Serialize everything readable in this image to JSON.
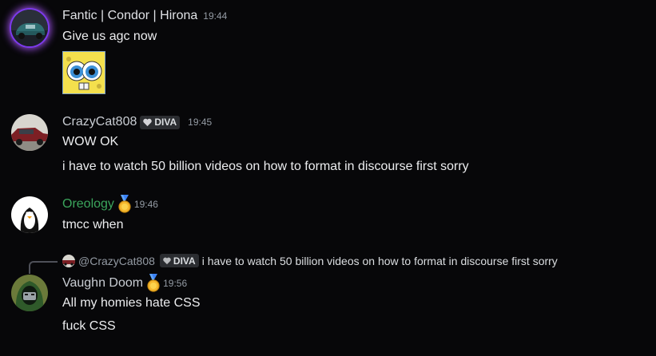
{
  "messages": [
    {
      "username": "Fantic | Condor | Hirona",
      "time": "19:44",
      "lines": [
        "Give us agc now"
      ],
      "attachment": "spongebob-emoji"
    },
    {
      "username": "CrazyCat808",
      "tag": "DIVA",
      "time": "19:45",
      "lines": [
        "WOW OK",
        "i have to watch 50 billion videos on how to format in discourse first sorry"
      ]
    },
    {
      "username": "Oreology",
      "username_color": "#3ba55c",
      "badge": "medal-icon",
      "time": "19:46",
      "lines": [
        "tmcc when"
      ]
    },
    {
      "reply": {
        "name": "@CrazyCat808",
        "tag": "DIVA",
        "text": "i have to watch 50 billion videos on how to format in discourse first sorry"
      },
      "username": "Vaughn Doom",
      "badge": "medal-icon",
      "time": "19:56",
      "lines": [
        "All my homies hate CSS",
        "fuck CSS"
      ]
    }
  ],
  "colors": {
    "background": "#070709",
    "accent_green": "#3ba55c",
    "avatar_ring": "#a855f7"
  }
}
